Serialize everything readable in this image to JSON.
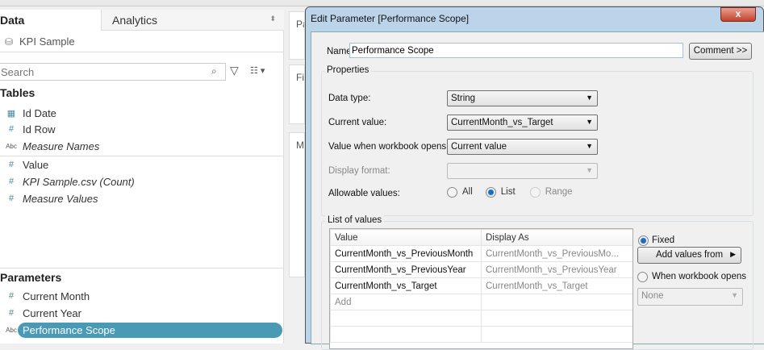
{
  "left_panel": {
    "tab_data": "Data",
    "tab_analytics": "Analytics",
    "datasource": "KPI Sample",
    "search_placeholder": "Search",
    "tables_heading": "Tables",
    "fields": [
      {
        "icon": "calendar",
        "label": "Id Date"
      },
      {
        "icon": "#",
        "label": "Id Row"
      },
      {
        "icon": "Abc",
        "label": "Measure Names"
      },
      {
        "icon": "#",
        "label": "Value"
      },
      {
        "icon": "#",
        "label": "KPI Sample.csv (Count)"
      },
      {
        "icon": "#",
        "label": "Measure Values"
      }
    ],
    "parameters_heading": "Parameters",
    "parameters": [
      {
        "icon": "#",
        "label": "Current Month"
      },
      {
        "icon": "#",
        "label": "Current Year"
      },
      {
        "icon": "Abc",
        "label": "Performance Scope"
      }
    ]
  },
  "shelves": [
    "Pa",
    "Fi",
    "Ma"
  ],
  "dialog": {
    "title": "Edit Parameter [Performance Scope]",
    "close": "x",
    "name_label": "Name:",
    "name_value": "Performance Scope",
    "comment_button": "Comment >>",
    "properties_title": "Properties",
    "data_type_label": "Data type:",
    "data_type": "String",
    "current_value_label": "Current value:",
    "current_value": "CurrentMonth_vs_Target",
    "open_value_label": "Value when workbook opens:",
    "open_value": "Current value",
    "display_format_label": "Display format:",
    "display_format": "",
    "allowable_label": "Allowable values:",
    "allowable_options": [
      "All",
      "List",
      "Range"
    ],
    "allowable_selected": "List",
    "list_title": "List of values",
    "columns": [
      "Value",
      "Display As"
    ],
    "rows": [
      [
        "CurrentMonth_vs_PreviousMonth",
        "CurrentMonth_vs_PreviousMo..."
      ],
      [
        "CurrentMonth_vs_PreviousYear",
        "CurrentMonth_vs_PreviousYear"
      ],
      [
        "CurrentMonth_vs_Target",
        "CurrentMonth_vs_Target"
      ]
    ],
    "add_placeholder": "Add",
    "fixed_label": "Fixed",
    "add_values_button": "Add values from",
    "when_opens_label": "When workbook opens",
    "when_opens_value": "None"
  },
  "colors": {
    "selected": "#4a9ab5",
    "accent": "#1a6fb5"
  }
}
